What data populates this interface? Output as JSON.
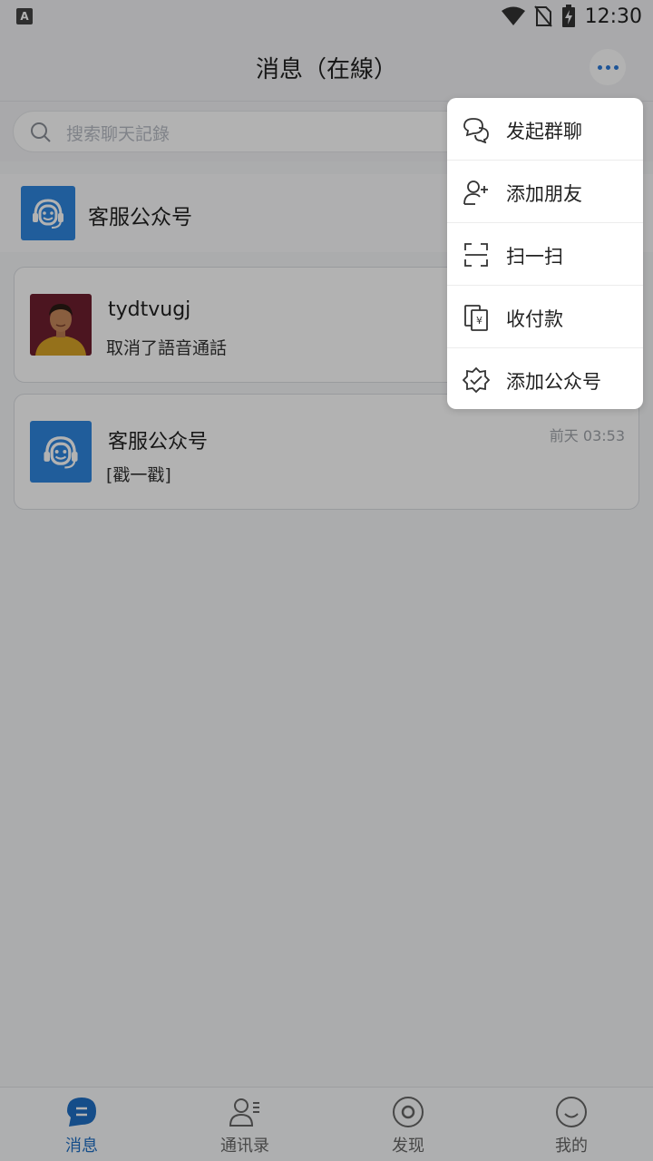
{
  "status_bar": {
    "app_icon_letter": "A",
    "time": "12:30"
  },
  "header": {
    "title": "消息（在線）"
  },
  "search": {
    "placeholder": "搜索聊天記錄"
  },
  "official_account": {
    "name": "客服公众号"
  },
  "conversations": [
    {
      "name": "tydtvugj",
      "message": "取消了語音通話",
      "time": ""
    },
    {
      "name": "客服公众号",
      "message": "[戳一戳]",
      "time": "前天 03:53"
    }
  ],
  "popup_menu": {
    "items": [
      {
        "label": "发起群聊",
        "icon": "group-chat-icon"
      },
      {
        "label": "添加朋友",
        "icon": "add-friend-icon"
      },
      {
        "label": "扫一扫",
        "icon": "scan-icon"
      },
      {
        "label": "收付款",
        "icon": "payment-icon"
      },
      {
        "label": "添加公众号",
        "icon": "add-official-account-icon"
      }
    ]
  },
  "tabs": [
    {
      "label": "消息",
      "active": true
    },
    {
      "label": "通讯录",
      "active": false
    },
    {
      "label": "发现",
      "active": false
    },
    {
      "label": "我的",
      "active": false
    }
  ],
  "colors": {
    "accent": "#1f6fc4",
    "avatar_blue": "#2f86de",
    "overlay": "rgba(0,0,0,0.30)"
  }
}
